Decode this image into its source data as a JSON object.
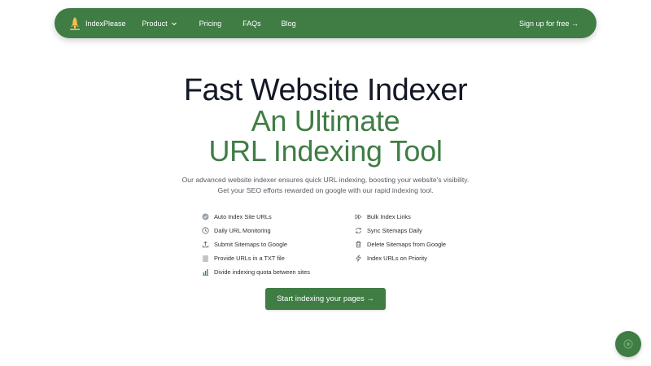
{
  "nav": {
    "brand": "IndexPlease",
    "brand_icon": "rocket-logo-icon",
    "links": [
      "Product",
      "Pricing",
      "FAQs",
      "Blog"
    ],
    "product_chevron_icon": "chevron-down-icon",
    "signup": "Sign up for free →"
  },
  "hero": {
    "title_line1": "Fast Website Indexer",
    "title_line2": "An Ultimate",
    "title_line3": "URL Indexing Tool",
    "desc_line1": "Our advanced website indexer ensures quick URL indexing, boosting your website's visibility.",
    "desc_line2": "Get your SEO efforts rewarded on google with our rapid indexing tool."
  },
  "features": {
    "left": [
      {
        "label": "Auto Index Site URLs",
        "icon": "auto-index-icon"
      },
      {
        "label": "Daily URL Monitoring",
        "icon": "clock-icon"
      },
      {
        "label": "Submit Sitemaps to Google",
        "icon": "upload-icon"
      },
      {
        "label": "Provide URLs in a TXT file",
        "icon": "list-icon"
      },
      {
        "label": "Divide indexing quota between sites",
        "icon": "bar-chart-icon"
      }
    ],
    "right": [
      {
        "label": "Bulk Index Links",
        "icon": "fast-forward-icon"
      },
      {
        "label": "Sync Sitemaps Daily",
        "icon": "sync-icon"
      },
      {
        "label": "Delete Sitemaps from Google",
        "icon": "trash-icon"
      },
      {
        "label": "Index URLs on Priority",
        "icon": "lightning-icon"
      }
    ]
  },
  "cta": {
    "label": "Start indexing your pages →"
  },
  "chat": {
    "icon": "chat-widget-icon"
  },
  "colors": {
    "brand_green": "#3f7d45",
    "heading_dark": "#121826"
  }
}
